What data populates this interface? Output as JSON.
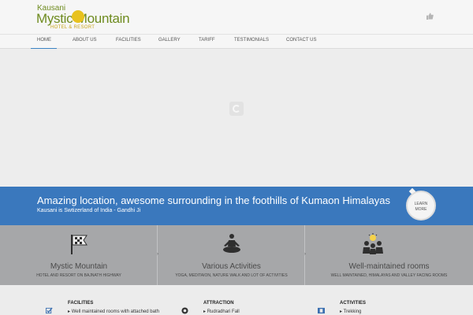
{
  "header": {
    "logo": {
      "line1": "Kausani",
      "line2": "Mystic Mountain",
      "line3": "HOTEL & RESORT"
    },
    "like_icon": "thumbs-up-icon"
  },
  "nav": {
    "items": [
      "HOME",
      "ABOUT US",
      "FACILITIES",
      "GALLERY",
      "TARIFF",
      "TESTIMONIALS",
      "CONTACT US"
    ],
    "active": "HOME"
  },
  "slider": {
    "loader_icon": "loading-spinner-icon"
  },
  "banner": {
    "headline": "Amazing location, awesome surrounding in the foothills of Kumaon Himalayas",
    "subheadline": "Kausani is Swtizerland of India - Gandhi Ji",
    "button_line1": "LEARN",
    "button_line2": "MORE"
  },
  "features": [
    {
      "icon": "flag-icon",
      "title": "Mystic Mountain",
      "desc": "HOTEL AND RESORT ON BAJNATH HIGHWAY"
    },
    {
      "icon": "meditation-icon",
      "title": "Various Activities",
      "desc": "YOGA, MEDITAION, NATURE WALK AND LOT OF ACTIVITIES"
    },
    {
      "icon": "people-icon",
      "title": "Well-maintained rooms",
      "desc": "WELL MAINTAINED, HIMALAYAS AND VALLEY FACING ROOMS"
    }
  ],
  "bottom": [
    {
      "icon": "checkbox-icon",
      "title": "FACILITIES",
      "item": "Well maintained rooms with attached bath"
    },
    {
      "icon": "camera-icon",
      "title": "ATTRACTION",
      "item": "Rudradhari Fall"
    },
    {
      "icon": "film-icon",
      "title": "ACTIVITIES",
      "item": "Trekking"
    }
  ],
  "colors": {
    "brand_green": "#6e8b1f",
    "brand_gold": "#c8a418",
    "accent_blue": "#3a78bd",
    "feature_gray": "#a6a7a9"
  }
}
